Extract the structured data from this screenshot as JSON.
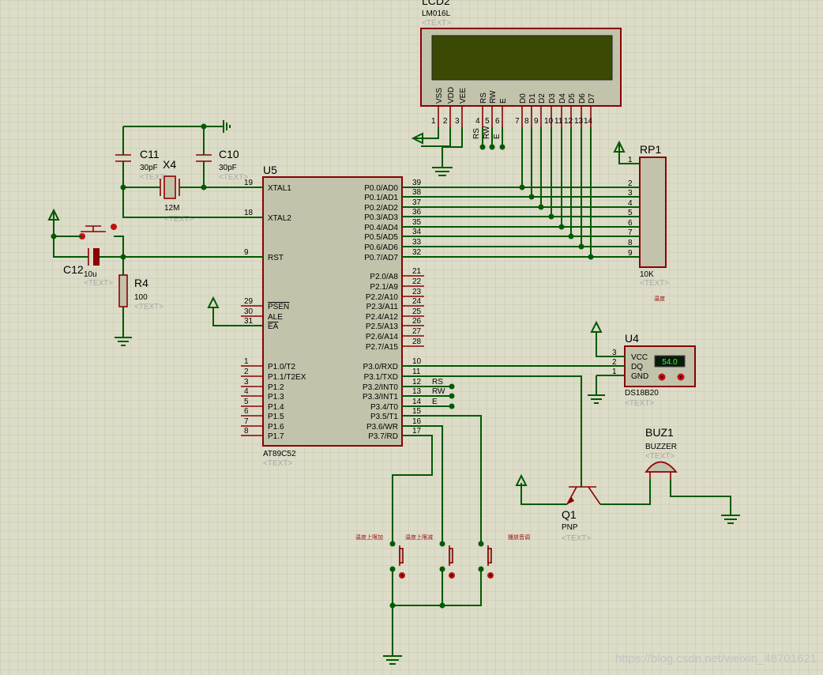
{
  "lcd": {
    "ref": "LCD2",
    "part": "LM016L",
    "text": "<TEXT>",
    "pins": [
      "VSS",
      "VDD",
      "VEE",
      "RS",
      "RW",
      "E",
      "D0",
      "D1",
      "D2",
      "D3",
      "D4",
      "D5",
      "D6",
      "D7"
    ],
    "pin_numbers": [
      "1",
      "2",
      "3",
      "4",
      "5",
      "6",
      "7",
      "8",
      "9",
      "10",
      "11",
      "12",
      "13",
      "14"
    ],
    "net_labels": [
      "RS",
      "RW",
      "E"
    ]
  },
  "mcu": {
    "ref": "U5",
    "part": "AT89C52",
    "text": "<TEXT>",
    "left_pins": [
      {
        "num": "19",
        "name": "XTAL1"
      },
      {
        "num": "18",
        "name": "XTAL2"
      },
      {
        "num": "9",
        "name": "RST"
      },
      {
        "num": "29",
        "name": "PSEN"
      },
      {
        "num": "30",
        "name": "ALE"
      },
      {
        "num": "31",
        "name": "EA"
      },
      {
        "num": "1",
        "name": "P1.0/T2"
      },
      {
        "num": "2",
        "name": "P1.1/T2EX"
      },
      {
        "num": "3",
        "name": "P1.2"
      },
      {
        "num": "4",
        "name": "P1.3"
      },
      {
        "num": "5",
        "name": "P1.4"
      },
      {
        "num": "6",
        "name": "P1.5"
      },
      {
        "num": "7",
        "name": "P1.6"
      },
      {
        "num": "8",
        "name": "P1.7"
      }
    ],
    "right_pins": [
      {
        "num": "39",
        "name": "P0.0/AD0"
      },
      {
        "num": "38",
        "name": "P0.1/AD1"
      },
      {
        "num": "37",
        "name": "P0.2/AD2"
      },
      {
        "num": "36",
        "name": "P0.3/AD3"
      },
      {
        "num": "35",
        "name": "P0.4/AD4"
      },
      {
        "num": "34",
        "name": "P0.5/AD5"
      },
      {
        "num": "33",
        "name": "P0.6/AD6"
      },
      {
        "num": "32",
        "name": "P0.7/AD7"
      },
      {
        "num": "21",
        "name": "P2.0/A8"
      },
      {
        "num": "22",
        "name": "P2.1/A9"
      },
      {
        "num": "23",
        "name": "P2.2/A10"
      },
      {
        "num": "24",
        "name": "P2.3/A11"
      },
      {
        "num": "25",
        "name": "P2.4/A12"
      },
      {
        "num": "26",
        "name": "P2.5/A13"
      },
      {
        "num": "27",
        "name": "P2.6/A14"
      },
      {
        "num": "28",
        "name": "P2.7/A15"
      },
      {
        "num": "10",
        "name": "P3.0/RXD"
      },
      {
        "num": "11",
        "name": "P3.1/TXD"
      },
      {
        "num": "12",
        "name": "P3.2/INT0"
      },
      {
        "num": "13",
        "name": "P3.3/INT1"
      },
      {
        "num": "14",
        "name": "P3.4/T0"
      },
      {
        "num": "15",
        "name": "P3.5/T1"
      },
      {
        "num": "16",
        "name": "P3.6/WR"
      },
      {
        "num": "17",
        "name": "P3.7/RD"
      }
    ],
    "net_labels": [
      "RS",
      "RW",
      "E"
    ]
  },
  "rp1": {
    "ref": "RP1",
    "value": "10K",
    "text": "<TEXT>",
    "note": "温度",
    "pins": [
      "1",
      "2",
      "3",
      "4",
      "5",
      "6",
      "7",
      "8",
      "9"
    ]
  },
  "c11": {
    "ref": "C11",
    "value": "30pF",
    "text": "<TEXT>"
  },
  "c10": {
    "ref": "C10",
    "value": "30pF",
    "text": "<TEXT>"
  },
  "x4": {
    "ref": "X4",
    "value": "12M",
    "text": "<TEXT>"
  },
  "c12": {
    "ref": "C12",
    "value": "10u",
    "text": "<TEXT>"
  },
  "r4": {
    "ref": "R4",
    "value": "100",
    "text": "<TEXT>"
  },
  "u4": {
    "ref": "U4",
    "part": "DS18B20",
    "text": "<TEXT>",
    "reading": "54.0",
    "pins": [
      {
        "num": "3",
        "name": "VCC"
      },
      {
        "num": "2",
        "name": "DQ"
      },
      {
        "num": "1",
        "name": "GND"
      }
    ]
  },
  "buz1": {
    "ref": "BUZ1",
    "part": "BUZZER",
    "text": "<TEXT>"
  },
  "q1": {
    "ref": "Q1",
    "part": "PNP",
    "text": "<TEXT>"
  },
  "buttons": [
    {
      "label": "温度上限加"
    },
    {
      "label": "温度上限减"
    },
    {
      "label": "播放音调"
    }
  ],
  "watermark": "https://blog.csdn.net/weixin_48701621",
  "colors": {
    "background": "#dcdcc8",
    "wire": "#005a00",
    "component": "#8b0000",
    "lcd_screen": "#3a4a04"
  }
}
